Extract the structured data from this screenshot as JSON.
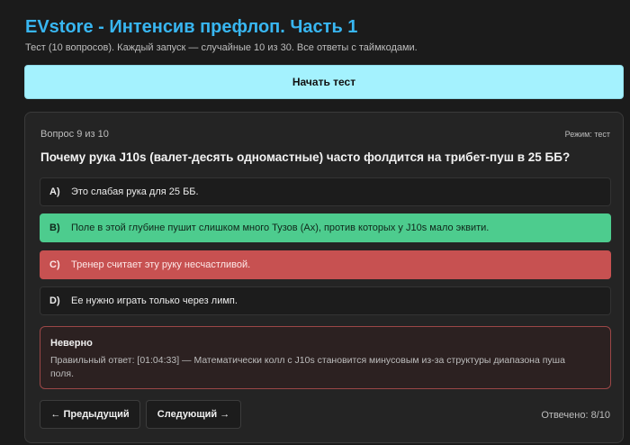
{
  "header": {
    "title": "EVstore - Интенсив префлоп. Часть 1",
    "subtitle": "Тест (10 вопросов). Каждый запуск — случайные 10 из 30. Все ответы с таймкодами."
  },
  "start_button": {
    "label": "Начать тест"
  },
  "quiz": {
    "counter": "Вопрос 9 из 10",
    "mode": "Режим: тест",
    "question": "Почему рука J10s (валет-десять одномастные) часто фолдится на трибет-пуш в 25 ББ?",
    "options": [
      {
        "letter": "A)",
        "text": "Это слабая рука для 25 ББ.",
        "state": "neutral"
      },
      {
        "letter": "B)",
        "text": "Поле в этой глубине пушит слишком много Тузов (Ax), против которых у J10s мало эквити.",
        "state": "correct"
      },
      {
        "letter": "C)",
        "text": "Тренер считает эту руку несчастливой.",
        "state": "wrong"
      },
      {
        "letter": "D)",
        "text": "Ее нужно играть только через лимп.",
        "state": "neutral"
      }
    ],
    "feedback": {
      "title": "Неверно",
      "text": "Правильный ответ: [01:04:33] — Математически колл с J10s становится минусовым из-за структуры диапазона пуша поля."
    },
    "nav": {
      "prev_label": "← Предыдущий",
      "next_label": "Следующий →"
    },
    "score": "Отвечено: 8/10"
  },
  "colors": {
    "title": "#38b6f1",
    "start_button_bg": "#a4f2fe",
    "correct_bg": "#4dcc8e",
    "wrong_bg": "#c75151",
    "feedback_border": "#9b4747"
  }
}
